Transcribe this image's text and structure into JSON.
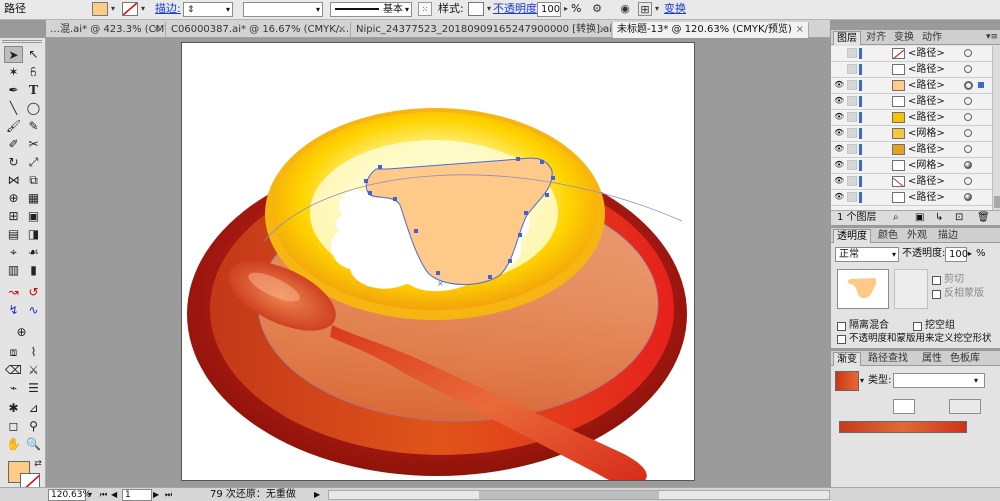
{
  "control_bar": {
    "object_type": "路径",
    "stroke_label": "描边:",
    "stroke_profile": "基本",
    "style_label": "样式:",
    "opacity_label": "不透明度",
    "opacity_value": "100",
    "percent": "%",
    "transform_label": "变换",
    "fill_color": "#ffcc88"
  },
  "tabs": [
    {
      "label": "…混.ai* @ 423.3% (CMYK/…",
      "close": "×"
    },
    {
      "label": "C06000387.ai* @ 16.67% (CMYK/…",
      "close": "×"
    },
    {
      "label": "Nipic_24377523_20180909165247900000 [转换].ai*",
      "close": "×"
    },
    {
      "label": "未标题-13* @ 120.63% (CMYK/预览)",
      "close": "×"
    }
  ],
  "status_bar": {
    "zoom": "120.63%",
    "artboard_number": "1",
    "history": "79 次还原：无重做"
  },
  "layers_panel": {
    "tabs": [
      "图层",
      "对齐",
      "变换",
      "动作"
    ],
    "rows": [
      {
        "name": "<路径>",
        "visible": false,
        "thumb": "#ffffff"
      },
      {
        "name": "<路径>",
        "visible": false,
        "thumb": "#ffffff"
      },
      {
        "name": "<路径>",
        "visible": true,
        "thumb": "#ffcc88"
      },
      {
        "name": "<路径>",
        "visible": true,
        "thumb": "#ffffff"
      },
      {
        "name": "<路径>",
        "visible": true,
        "thumb": "#f5c400"
      },
      {
        "name": "<网格>",
        "visible": true,
        "thumb": "#f7c640"
      },
      {
        "name": "<路径>",
        "visible": true,
        "thumb": "#e8a020"
      },
      {
        "name": "<网格>",
        "visible": true,
        "thumb": "#ffffff"
      },
      {
        "name": "<路径>",
        "visible": true,
        "thumb": "#ffffff"
      },
      {
        "name": "<路径>",
        "visible": true,
        "thumb": "#ffffff"
      }
    ],
    "footer": "1 个图层"
  },
  "transparency_panel": {
    "tabs": [
      "透明度",
      "颜色",
      "外观",
      "描边"
    ],
    "blend_mode": "正常",
    "opacity_label": "不透明度:",
    "opacity_value": "100",
    "percent": "%",
    "clip_label": "剪切",
    "invert_mask_label": "反相蒙版",
    "isolate_label": "隔离混合",
    "knockout_label": "挖空组",
    "knockout_shape_label": "不透明度和蒙版用来定义挖空形状"
  },
  "gradient_panel": {
    "tabs": [
      "渐变",
      "路径查找",
      "属性",
      "色板库"
    ],
    "type_label": "类型:",
    "type_value": "",
    "swatch_color": "#e05a20"
  },
  "tools_panel": {
    "fill_color": "#ffcc88",
    "stroke_state": "none"
  }
}
